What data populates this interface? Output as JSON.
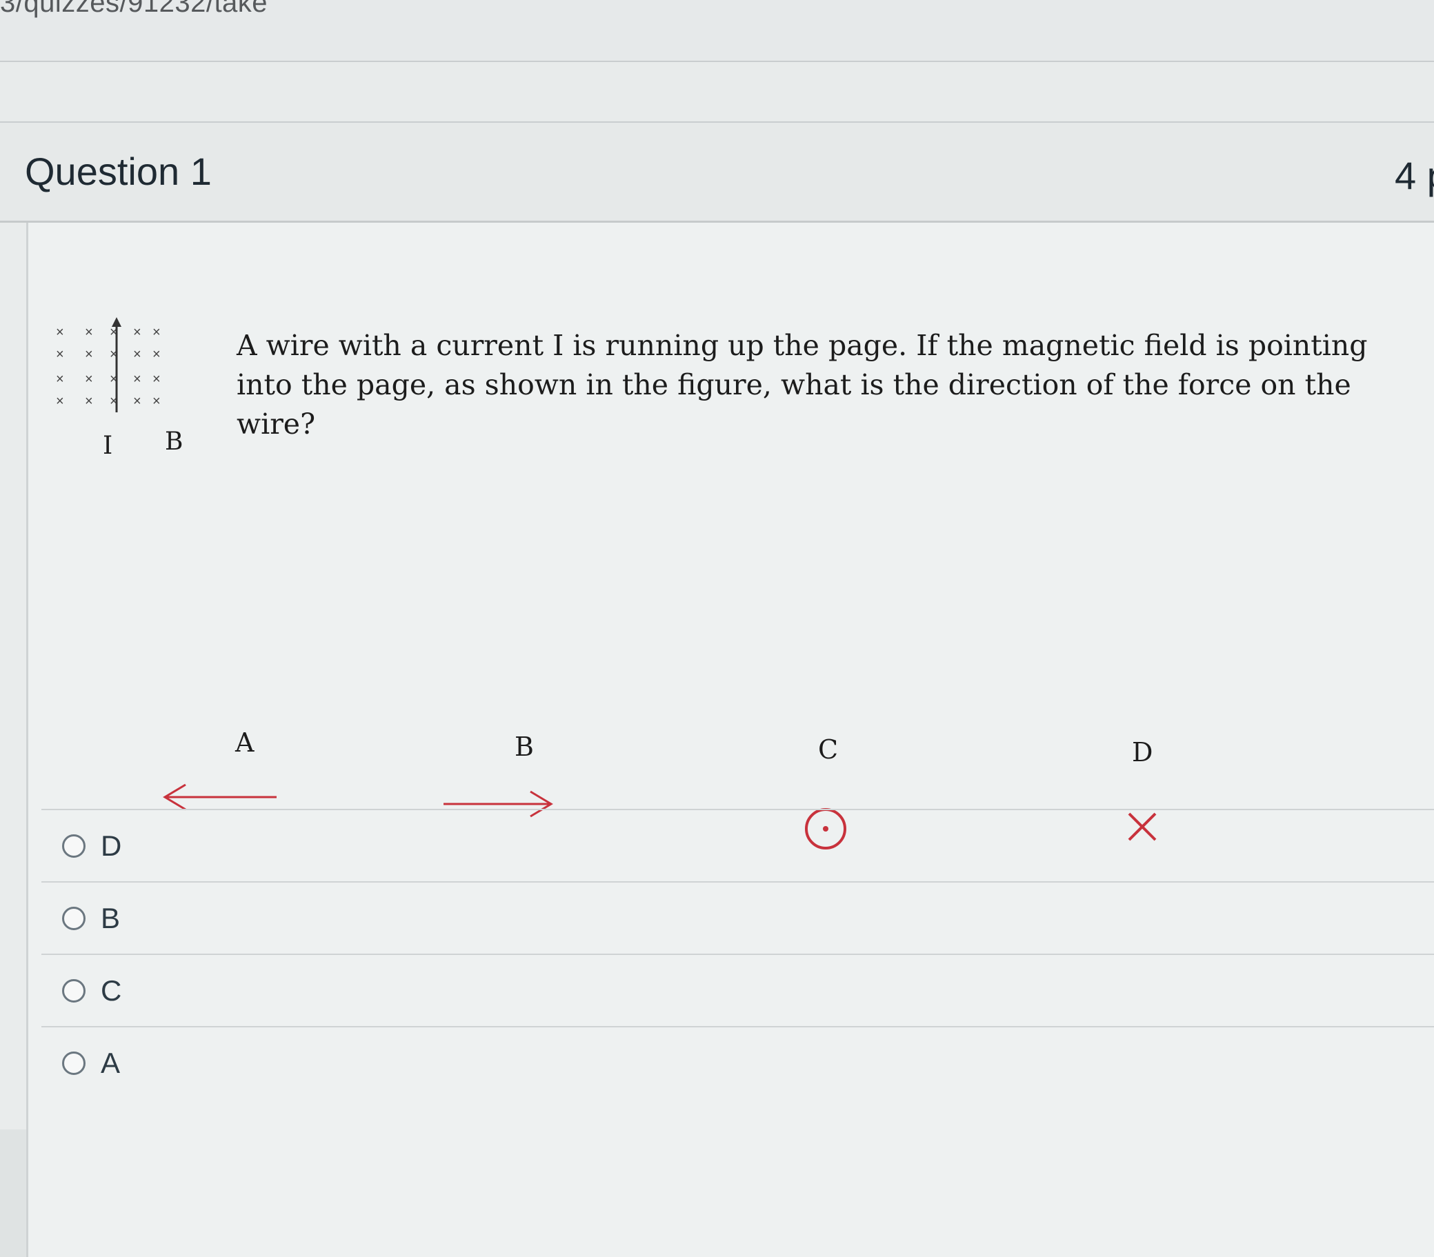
{
  "browser": {
    "url": "3/quizzes/91232/take"
  },
  "question": {
    "title": "Question 1",
    "points": "4 p",
    "text": "A wire with a current I is running up the page. If the magnetic field is pointing into the page, as shown in the figure,  what is the direction of the force on the wire?"
  },
  "figure": {
    "current_label": "I",
    "field_label": "B",
    "field_symbol": "×",
    "options": [
      {
        "label": "A",
        "icon": "arrow-left-icon"
      },
      {
        "label": "B",
        "icon": "arrow-right-icon"
      },
      {
        "label": "C",
        "icon": "dot-out-of-page-icon"
      },
      {
        "label": "D",
        "icon": "x-into-page-icon"
      }
    ],
    "arrow_color": "#c8323c"
  },
  "answers": [
    {
      "label": "D",
      "selected": false
    },
    {
      "label": "B",
      "selected": false
    },
    {
      "label": "C",
      "selected": false
    },
    {
      "label": "A",
      "selected": false
    }
  ]
}
